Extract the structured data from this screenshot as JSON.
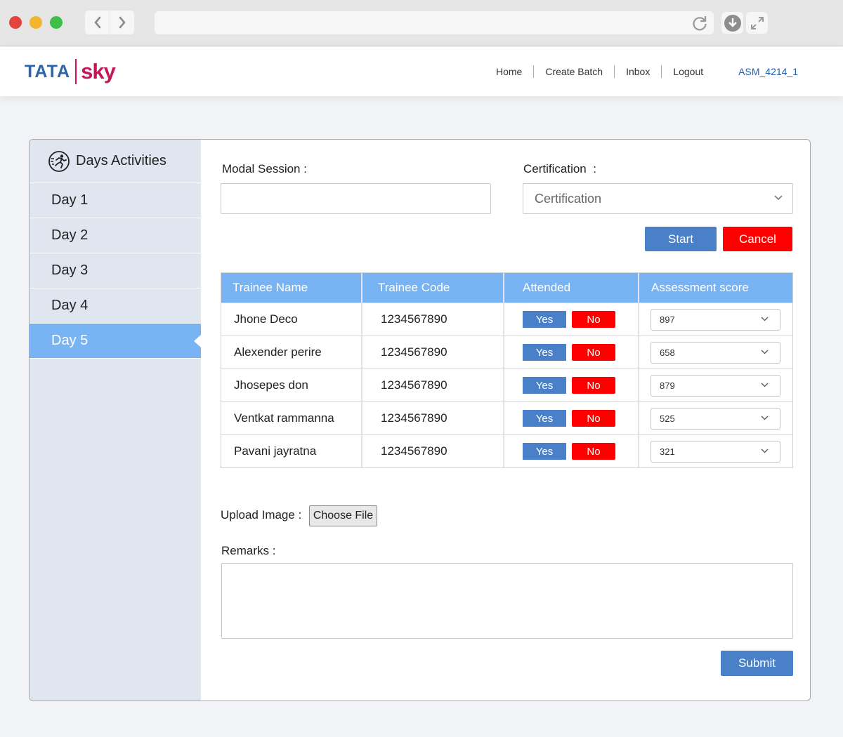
{
  "browser": {
    "back_icon": "chevron-left-icon",
    "forward_icon": "chevron-right-icon",
    "reload_icon": "reload-icon",
    "download_icon": "download-icon",
    "fullscreen_icon": "fullscreen-icon"
  },
  "header": {
    "logo_tata": "TATA",
    "logo_sky": "sky",
    "nav": {
      "home": "Home",
      "create_batch": "Create Batch",
      "inbox": "Inbox",
      "logout": "Logout",
      "user": "ASM_4214_1"
    }
  },
  "sidebar": {
    "title": "Days Activities",
    "icon": "runner-icon",
    "days": [
      "Day 1",
      "Day 2",
      "Day 3",
      "Day 4",
      "Day 5"
    ],
    "active_day": "Day 5"
  },
  "form": {
    "modal_session_label": "Modal Session :",
    "modal_session_value": "",
    "certification_label": "Certification  :",
    "certification_selected": "Certification",
    "start_label": "Start",
    "cancel_label": "Cancel",
    "upload_label": "Upload Image :",
    "choose_file_label": "Choose File",
    "remarks_label": "Remarks :",
    "remarks_value": "",
    "submit_label": "Submit"
  },
  "table": {
    "headers": [
      "Trainee Name",
      "Trainee Code",
      "Attended",
      "Assessment score"
    ],
    "yes_label": "Yes",
    "no_label": "No",
    "rows": [
      {
        "name": "Jhone Deco",
        "code": "1234567890",
        "score": "897"
      },
      {
        "name": "Alexender perire",
        "code": "1234567890",
        "score": "658"
      },
      {
        "name": "Jhosepes don",
        "code": "1234567890",
        "score": "879"
      },
      {
        "name": "Ventkat rammanna",
        "code": "1234567890",
        "score": "525"
      },
      {
        "name": "Pavani jayratna",
        "code": "1234567890",
        "score": "321"
      }
    ]
  },
  "colors": {
    "accent_blue": "#78b4f4",
    "button_blue": "#4a80c8",
    "button_red": "#ff0000",
    "link_blue": "#2062b3"
  }
}
